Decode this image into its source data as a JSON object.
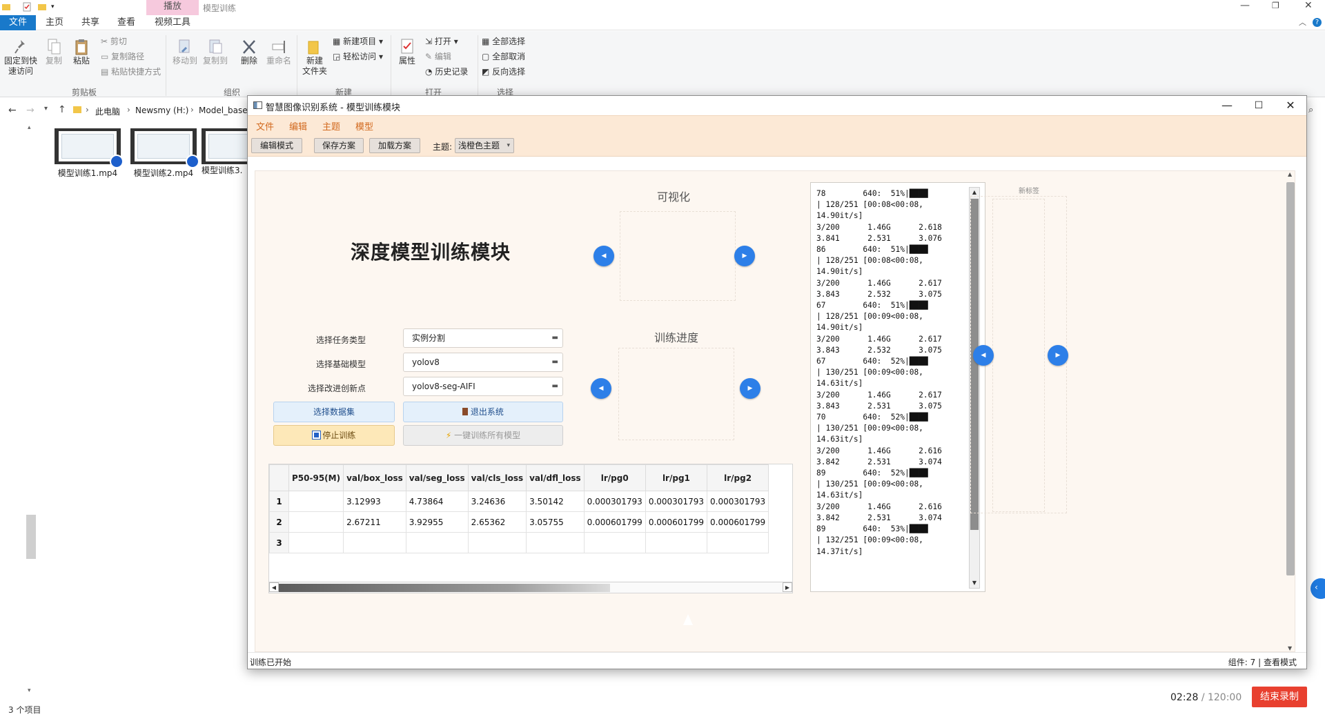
{
  "explorer": {
    "context_tab": "播放",
    "window_title": "模型训练",
    "tabs": [
      "文件",
      "主页",
      "共享",
      "查看",
      "视频工具"
    ],
    "ribbon": {
      "pin_label": "固定到快\n速访问",
      "copy_label": "复制",
      "paste_label": "粘贴",
      "cut_label": "剪切",
      "copy_path_label": "复制路径",
      "paste_shortcut_label": "粘贴快捷方式",
      "clipboard_group": "剪贴板",
      "move_to_label": "移动到",
      "copy_to_label": "复制到",
      "delete_label": "删除",
      "rename_label": "重命名",
      "organize_group": "组织",
      "new_folder_label": "新建\n文件夹",
      "new_item_label": "新建项目",
      "easy_access_label": "轻松访问",
      "new_group": "新建",
      "properties_label": "属性",
      "open_label": "打开",
      "edit_label": "编辑",
      "history_label": "历史记录",
      "open_group": "打开",
      "select_all_label": "全部选择",
      "select_none_label": "全部取消",
      "invert_label": "反向选择",
      "select_group": "选择"
    },
    "breadcrumb": [
      "此电脑",
      "Newsmy (H:)",
      "Model_base"
    ],
    "files": [
      {
        "name": "模型训练1.mp4"
      },
      {
        "name": "模型训练2.mp4"
      },
      {
        "name": "模型训练3."
      }
    ],
    "item_count": "3 个项目",
    "recorder_time": "02:28",
    "recorder_total": "/ 120:00",
    "recorder_stop": "结束录制"
  },
  "app": {
    "title": "智慧图像识别系统 - 模型训练模块",
    "menu": [
      "文件",
      "编辑",
      "主题",
      "模型"
    ],
    "toolbar": {
      "edit_mode": "编辑模式",
      "save_plan": "保存方案",
      "load_plan": "加载方案",
      "theme_label": "主题:",
      "theme_value": "浅橙色主题"
    },
    "heading": "深度模型训练模块",
    "form": {
      "task_label": "选择任务类型",
      "task_value": "实例分割",
      "model_label": "选择基础模型",
      "model_value": "yolov8",
      "innovation_label": "选择改进创新点",
      "innovation_value": "yolov8-seg-AIFI"
    },
    "buttons": {
      "select_dataset": "选择数据集",
      "exit_system": "退出系统",
      "stop_training": "停止训练",
      "train_all": "一键训练所有模型"
    },
    "cards": {
      "visual_title": "可视化",
      "progress_title": "训练进度",
      "tag_title": "新标签"
    },
    "table": {
      "columns": [
        "P50-95(M)",
        "val/box_loss",
        "val/seg_loss",
        "val/cls_loss",
        "val/dfl_loss",
        "lr/pg0",
        "lr/pg1",
        "lr/pg2"
      ],
      "rows": [
        {
          "num": "1",
          "cells": [
            "",
            "3.12993",
            "4.73864",
            "3.24636",
            "3.50142",
            "0.000301793",
            "0.000301793",
            "0.000301793"
          ]
        },
        {
          "num": "2",
          "cells": [
            "",
            "2.67211",
            "3.92955",
            "2.65362",
            "3.05755",
            "0.000601799",
            "0.000601799",
            "0.000601799"
          ]
        },
        {
          "num": "3",
          "cells": [
            "",
            "",
            "",
            "",
            "",
            "",
            "",
            ""
          ]
        }
      ]
    },
    "log_lines": [
      "78        640:  51%|████",
      "| 128/251 [00:08<00:08,",
      "14.90it/s]",
      "3/200      1.46G      2.618",
      "3.841      2.531      3.076",
      "86        640:  51%|████",
      "| 128/251 [00:08<00:08,",
      "14.90it/s]",
      "3/200      1.46G      2.617",
      "3.843      2.532      3.075",
      "67        640:  51%|████",
      "| 128/251 [00:09<00:08,",
      "14.90it/s]",
      "3/200      1.46G      2.617",
      "3.843      2.532      3.075",
      "67        640:  52%|████",
      "| 130/251 [00:09<00:08,",
      "14.63it/s]",
      "3/200      1.46G      2.617",
      "3.843      2.531      3.075",
      "70        640:  52%|████",
      "| 130/251 [00:09<00:08,",
      "14.63it/s]",
      "3/200      1.46G      2.616",
      "3.842      2.531      3.074",
      "89        640:  52%|████",
      "| 130/251 [00:09<00:08,",
      "14.63it/s]",
      "3/200      1.46G      2.616",
      "3.842      2.531      3.074",
      "89        640:  53%|████",
      "| 132/251 [00:09<00:08,",
      "14.37it/s]"
    ],
    "status": {
      "message": "训练已开始",
      "components": "组件: 7",
      "mode": "查看模式"
    },
    "colors": {
      "menubar_bg": "#fce9d6",
      "menu_text": "#d2691e",
      "accent_blue": "#2d7fe8",
      "stop_btn_bg": "#fde8b8",
      "dataset_btn_bg": "#e4f0fb",
      "record_red": "#e8402f"
    }
  }
}
